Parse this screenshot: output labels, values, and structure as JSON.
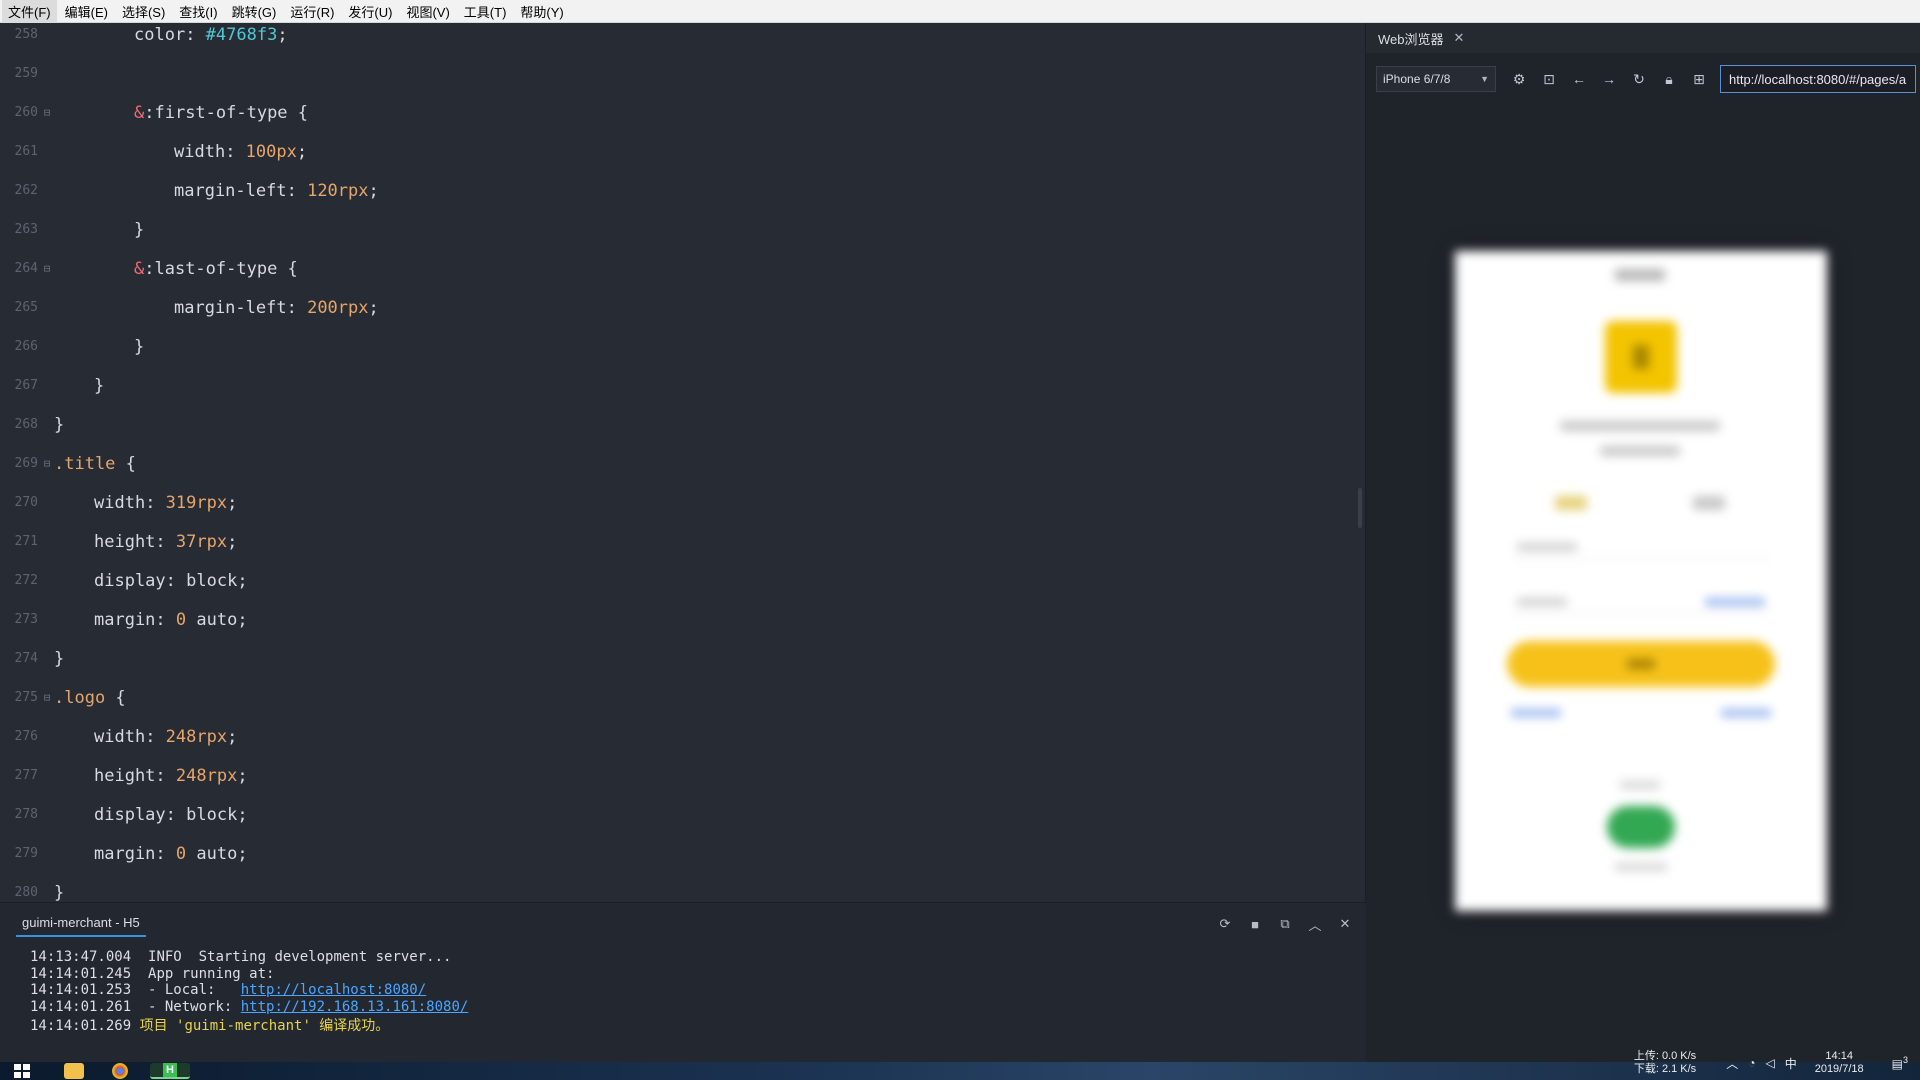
{
  "menu": [
    "文件(F)",
    "编辑(E)",
    "选择(S)",
    "查找(I)",
    "跳转(G)",
    "运行(R)",
    "发行(U)",
    "视图(V)",
    "工具(T)",
    "帮助(Y)"
  ],
  "editor": {
    "lines": [
      {
        "num": "258",
        "fold": "",
        "indent": 2,
        "tokens": [
          [
            "prop",
            "color"
          ],
          [
            "punc",
            ": "
          ],
          [
            "color",
            "#4768f3"
          ],
          [
            "punc",
            ";"
          ]
        ]
      },
      {
        "num": "259",
        "fold": "",
        "indent": 0,
        "tokens": []
      },
      {
        "num": "260",
        "fold": "⊟",
        "indent": 2,
        "tokens": [
          [
            "amp",
            "&"
          ],
          [
            "pseudo",
            ":first-of-type"
          ],
          [
            "punc",
            " {"
          ]
        ]
      },
      {
        "num": "261",
        "fold": "",
        "indent": 3,
        "tokens": [
          [
            "prop",
            "width"
          ],
          [
            "punc",
            ": "
          ],
          [
            "num",
            "100px"
          ],
          [
            "punc",
            ";"
          ]
        ]
      },
      {
        "num": "262",
        "fold": "",
        "indent": 3,
        "tokens": [
          [
            "prop",
            "margin-left"
          ],
          [
            "punc",
            ": "
          ],
          [
            "num",
            "120rpx"
          ],
          [
            "punc",
            ";"
          ]
        ]
      },
      {
        "num": "263",
        "fold": "",
        "indent": 2,
        "tokens": [
          [
            "punc",
            "}"
          ]
        ]
      },
      {
        "num": "264",
        "fold": "⊟",
        "indent": 2,
        "tokens": [
          [
            "amp",
            "&"
          ],
          [
            "pseudo",
            ":last-of-type"
          ],
          [
            "punc",
            " {"
          ]
        ]
      },
      {
        "num": "265",
        "fold": "",
        "indent": 3,
        "tokens": [
          [
            "prop",
            "margin-left"
          ],
          [
            "punc",
            ": "
          ],
          [
            "num",
            "200rpx"
          ],
          [
            "punc",
            ";"
          ]
        ]
      },
      {
        "num": "266",
        "fold": "",
        "indent": 2,
        "tokens": [
          [
            "punc",
            "}"
          ]
        ]
      },
      {
        "num": "267",
        "fold": "",
        "indent": 1,
        "tokens": [
          [
            "punc",
            "}"
          ]
        ]
      },
      {
        "num": "268",
        "fold": "",
        "indent": 0,
        "tokens": [
          [
            "punc",
            "}"
          ]
        ]
      },
      {
        "num": "269",
        "fold": "⊟",
        "indent": 0,
        "tokens": [
          [
            "sel",
            ".title"
          ],
          [
            "punc",
            " {"
          ]
        ]
      },
      {
        "num": "270",
        "fold": "",
        "indent": 1,
        "tokens": [
          [
            "prop",
            "width"
          ],
          [
            "punc",
            ": "
          ],
          [
            "num",
            "319rpx"
          ],
          [
            "punc",
            ";"
          ]
        ]
      },
      {
        "num": "271",
        "fold": "",
        "indent": 1,
        "tokens": [
          [
            "prop",
            "height"
          ],
          [
            "punc",
            ": "
          ],
          [
            "num",
            "37rpx"
          ],
          [
            "punc",
            ";"
          ]
        ]
      },
      {
        "num": "272",
        "fold": "",
        "indent": 1,
        "tokens": [
          [
            "prop",
            "display"
          ],
          [
            "punc",
            ": "
          ],
          [
            "kw",
            "block"
          ],
          [
            "punc",
            ";"
          ]
        ]
      },
      {
        "num": "273",
        "fold": "",
        "indent": 1,
        "tokens": [
          [
            "prop",
            "margin"
          ],
          [
            "punc",
            ": "
          ],
          [
            "num",
            "0"
          ],
          [
            "kw",
            " auto"
          ],
          [
            "punc",
            ";"
          ]
        ]
      },
      {
        "num": "274",
        "fold": "",
        "indent": 0,
        "tokens": [
          [
            "punc",
            "}"
          ]
        ]
      },
      {
        "num": "275",
        "fold": "⊟",
        "indent": 0,
        "tokens": [
          [
            "sel",
            ".logo"
          ],
          [
            "punc",
            " {"
          ]
        ]
      },
      {
        "num": "276",
        "fold": "",
        "indent": 1,
        "tokens": [
          [
            "prop",
            "width"
          ],
          [
            "punc",
            ": "
          ],
          [
            "num",
            "248rpx"
          ],
          [
            "punc",
            ";"
          ]
        ]
      },
      {
        "num": "277",
        "fold": "",
        "indent": 1,
        "tokens": [
          [
            "prop",
            "height"
          ],
          [
            "punc",
            ": "
          ],
          [
            "num",
            "248rpx"
          ],
          [
            "punc",
            ";"
          ]
        ]
      },
      {
        "num": "278",
        "fold": "",
        "indent": 1,
        "tokens": [
          [
            "prop",
            "display"
          ],
          [
            "punc",
            ": "
          ],
          [
            "kw",
            "block"
          ],
          [
            "punc",
            ";"
          ]
        ]
      },
      {
        "num": "279",
        "fold": "",
        "indent": 1,
        "tokens": [
          [
            "prop",
            "margin"
          ],
          [
            "punc",
            ": "
          ],
          [
            "num",
            "0"
          ],
          [
            "kw",
            " auto"
          ],
          [
            "punc",
            ";"
          ]
        ]
      },
      {
        "num": "280",
        "fold": "",
        "indent": 0,
        "tokens": [
          [
            "punc",
            "}"
          ]
        ]
      }
    ]
  },
  "console": {
    "tab_label": "guimi-merchant - H5",
    "logs": [
      {
        "ts": "14:13:47.004",
        "text": "  INFO  Starting development server...",
        "link": "",
        "ok": ""
      },
      {
        "ts": "14:14:01.245",
        "text": "  App running at:",
        "link": "",
        "ok": ""
      },
      {
        "ts": "14:14:01.253",
        "text": "  - Local:   ",
        "link": "http://localhost:8080/",
        "ok": ""
      },
      {
        "ts": "14:14:01.261",
        "text": "  - Network: ",
        "link": "http://192.168.13.161:8080/",
        "ok": ""
      },
      {
        "ts": "14:14:01.269",
        "text": " ",
        "link": "",
        "ok": "项目 'guimi-merchant' 编译成功。"
      }
    ]
  },
  "browser": {
    "tab_label": "Web浏览器",
    "device": "iPhone 6/7/8",
    "address": "http://localhost:8080/#/pages/a"
  },
  "tray": {
    "upload": "上传: 0.0 K/s",
    "download": "下载: 2.1 K/s",
    "ime": "中",
    "time": "14:14",
    "date": "2019/7/18",
    "notifications": "3"
  }
}
